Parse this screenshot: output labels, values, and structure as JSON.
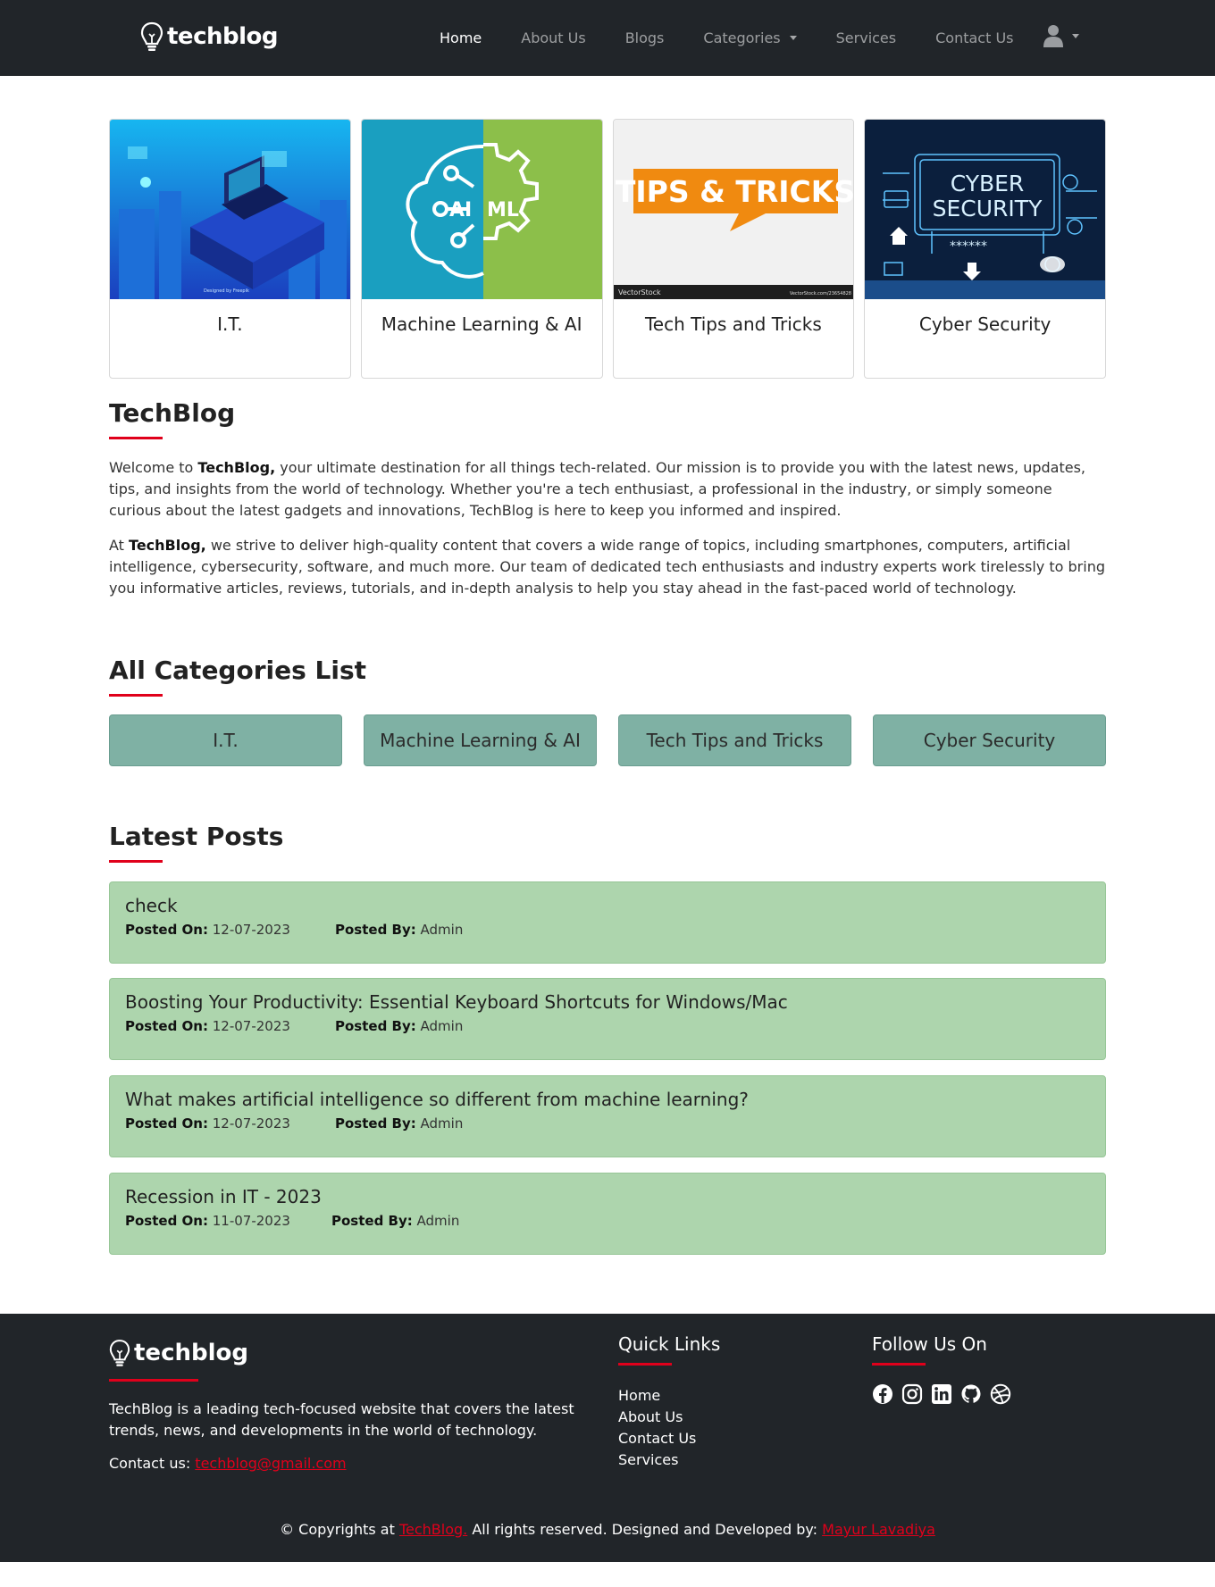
{
  "nav": {
    "brand": "techblog",
    "links": [
      "Home",
      "About Us",
      "Blogs",
      "Categories",
      "Services",
      "Contact Us"
    ]
  },
  "cards": [
    {
      "title": "I.T.",
      "image_text": "Designed by Freepik"
    },
    {
      "title": "Machine Learning & AI",
      "image_text_1": "AI",
      "image_text_2": "ML"
    },
    {
      "title": "Tech Tips and Tricks",
      "image_text": "TIPS & TRICKS",
      "image_footer": "VectorStock",
      "image_footer_2": "VectorStock.com/23654828"
    },
    {
      "title": "Cyber Security",
      "image_text_1": "CYBER",
      "image_text_2": "SECURITY",
      "image_text_3": "******"
    }
  ],
  "about": {
    "title": "TechBlog",
    "p1_prefix": "Welcome to ",
    "p1_bold": "TechBlog,",
    "p1_rest": " your ultimate destination for all things tech-related. Our mission is to provide you with the latest news, updates, tips, and insights from the world of technology. Whether you're a tech enthusiast, a professional in the industry, or simply someone curious about the latest gadgets and innovations, TechBlog is here to keep you informed and inspired.",
    "p2_prefix": "At ",
    "p2_bold": "TechBlog,",
    "p2_rest": " we strive to deliver high-quality content that covers a wide range of topics, including smartphones, computers, artificial intelligence, cybersecurity, software, and much more. Our team of dedicated tech enthusiasts and industry experts work tirelessly to bring you informative articles, reviews, tutorials, and in-depth analysis to help you stay ahead in the fast-paced world of technology."
  },
  "categories": {
    "title": "All Categories List",
    "items": [
      "I.T.",
      "Machine Learning & AI",
      "Tech Tips and Tricks",
      "Cyber Security"
    ]
  },
  "latest": {
    "title": "Latest Posts",
    "posted_on_label": "Posted On:",
    "posted_by_label": "Posted By:",
    "posts": [
      {
        "title": "check",
        "date": "12-07-2023",
        "author": "Admin"
      },
      {
        "title": "Boosting Your Productivity: Essential Keyboard Shortcuts for Windows/Mac",
        "date": "12-07-2023",
        "author": "Admin"
      },
      {
        "title": "What makes artificial intelligence so different from machine learning?",
        "date": "12-07-2023",
        "author": "Admin"
      },
      {
        "title": "Recession in IT - 2023",
        "date": "11-07-2023",
        "author": "Admin"
      }
    ]
  },
  "footer": {
    "brand": "techblog",
    "description": "TechBlog is a leading tech-focused website that covers the latest trends, news, and developments in the world of technology.",
    "contact_label": "Contact us: ",
    "contact_email": "techblog@gmail.com",
    "quick_links_title": "Quick Links",
    "quick_links": [
      "Home",
      "About Us",
      "Contact Us",
      "Services"
    ],
    "follow_title": "Follow Us On",
    "socials": [
      "facebook-icon",
      "instagram-icon",
      "linkedin-icon",
      "github-icon",
      "dribbble-icon"
    ],
    "copy_prefix": "© Copyrights at ",
    "copy_link": "TechBlog.",
    "copy_mid": " All rights reserved. Designed and Developed by: ",
    "copy_author": "Mayur Lavadiya"
  },
  "colors": {
    "accent": "#e0001b",
    "dark": "#212529",
    "category_button": "#7fb1a4",
    "post_bg": "#add5ad"
  }
}
